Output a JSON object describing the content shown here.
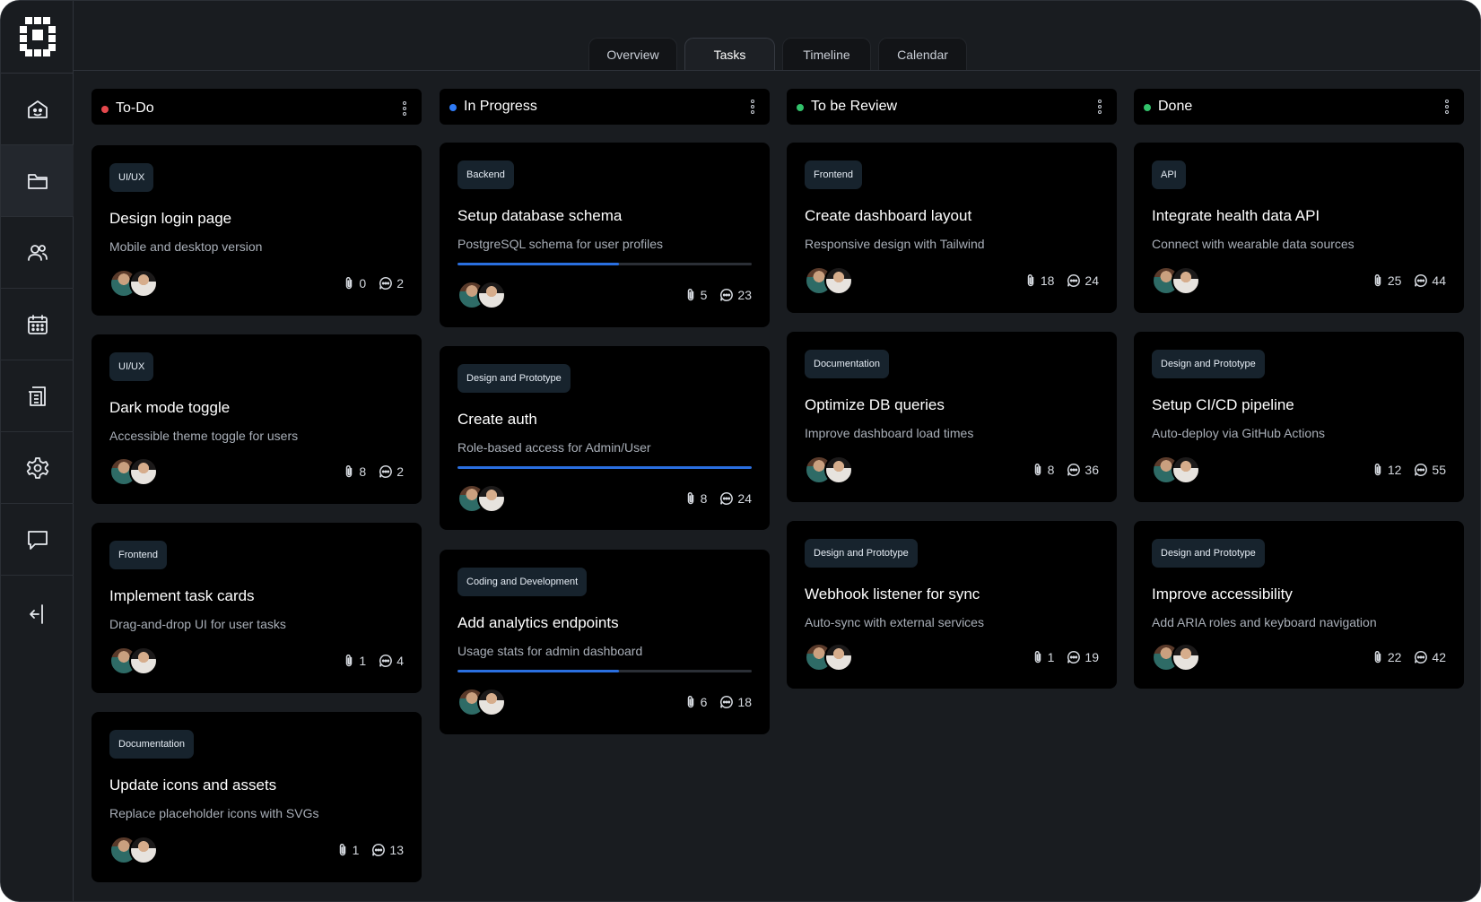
{
  "colors": {
    "todo": "#e5484d",
    "in_progress": "#2f7bf6",
    "to_be_review": "#32c26b",
    "done": "#32c26b",
    "progress_fill": "#2a6fe0"
  },
  "sidebar": {
    "items": [
      {
        "icon": "home-icon"
      },
      {
        "icon": "folder-icon"
      },
      {
        "icon": "users-icon"
      },
      {
        "icon": "calendar-icon"
      },
      {
        "icon": "documents-icon"
      },
      {
        "icon": "gear-icon"
      },
      {
        "icon": "chat-icon"
      }
    ],
    "collapse_icon": "collapse-sidebar-icon"
  },
  "tabs": [
    {
      "label": "Overview"
    },
    {
      "label": "Tasks"
    },
    {
      "label": "Timeline"
    },
    {
      "label": "Calendar"
    }
  ],
  "columns": [
    {
      "title": "To-Do",
      "cards": [
        {
          "tag": "UI/UX",
          "title": "Design login page",
          "subtitle": "Mobile and desktop version",
          "attachments": "0",
          "comments": "2"
        },
        {
          "tag": "UI/UX",
          "title": "Dark mode toggle",
          "subtitle": "Accessible theme toggle for users",
          "attachments": "8",
          "comments": "2"
        },
        {
          "tag": "Frontend",
          "title": "Implement task cards",
          "subtitle": "Drag-and-drop UI for user tasks",
          "attachments": "1",
          "comments": "4"
        },
        {
          "tag": "Documentation",
          "title": "Update icons and assets",
          "subtitle": "Replace placeholder icons with SVGs",
          "attachments": "1",
          "comments": "13"
        }
      ]
    },
    {
      "title": "In Progress",
      "cards": [
        {
          "tag": "Backend",
          "title": "Setup database schema",
          "subtitle": "PostgreSQL schema for user profiles",
          "progress": 0.55,
          "attachments": "5",
          "comments": "23"
        },
        {
          "tag": "Design and Prototype",
          "title": "Create auth",
          "subtitle": "Role-based access for Admin/User",
          "progress": 1.0,
          "attachments": "8",
          "comments": "24"
        },
        {
          "tag": "Coding and Development",
          "title": "Add analytics endpoints",
          "subtitle": "Usage stats for admin dashboard",
          "progress": 0.55,
          "attachments": "6",
          "comments": "18"
        }
      ]
    },
    {
      "title": "To be Review",
      "cards": [
        {
          "tag": "Frontend",
          "title": "Create dashboard layout",
          "subtitle": "Responsive design with Tailwind",
          "attachments": "18",
          "comments": "24"
        },
        {
          "tag": "Documentation",
          "title": "Optimize DB queries",
          "subtitle": "Improve dashboard load times",
          "attachments": "8",
          "comments": "36"
        },
        {
          "tag": "Design and Prototype",
          "title": "Webhook listener for sync",
          "subtitle": "Auto-sync with external services",
          "attachments": "1",
          "comments": "19"
        }
      ]
    },
    {
      "title": "Done",
      "cards": [
        {
          "tag": "API",
          "title": "Integrate health data API",
          "subtitle": "Connect with wearable data sources",
          "attachments": "25",
          "comments": "44"
        },
        {
          "tag": "Design and Prototype",
          "title": "Setup CI/CD pipeline",
          "subtitle": "Auto-deploy via GitHub Actions",
          "attachments": "12",
          "comments": "55"
        },
        {
          "tag": "Design and Prototype",
          "title": "Improve accessibility",
          "subtitle": "Add ARIA roles and keyboard navigation",
          "attachments": "22",
          "comments": "42"
        }
      ]
    }
  ]
}
